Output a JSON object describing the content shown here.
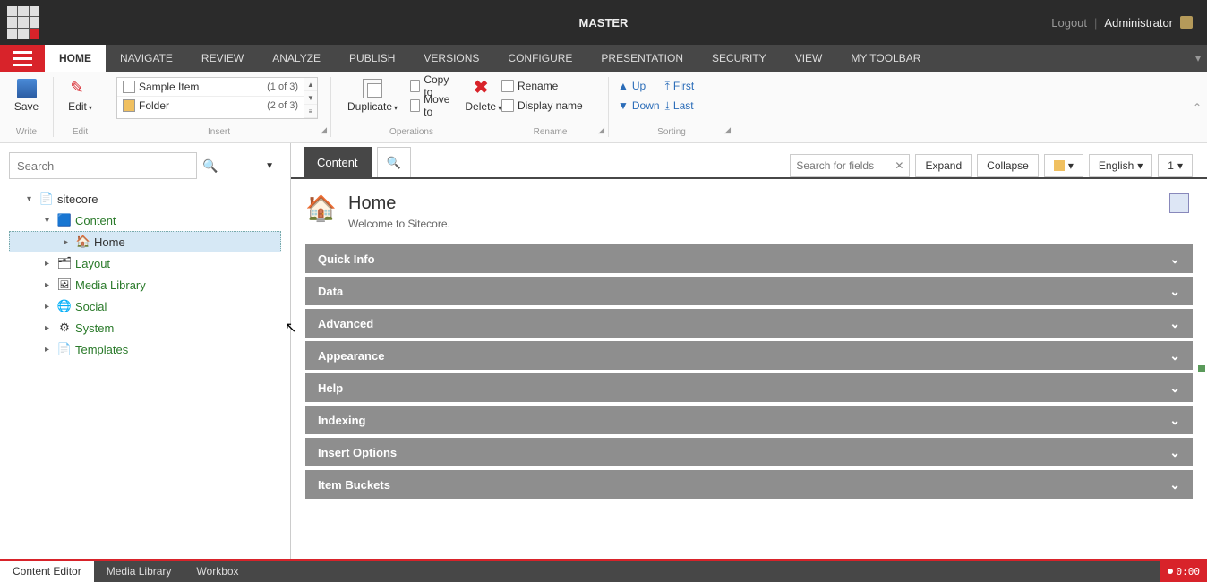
{
  "topbar": {
    "title": "MASTER",
    "logout": "Logout",
    "user": "Administrator"
  },
  "mainnav": {
    "tabs": [
      "HOME",
      "NAVIGATE",
      "REVIEW",
      "ANALYZE",
      "PUBLISH",
      "VERSIONS",
      "CONFIGURE",
      "PRESENTATION",
      "SECURITY",
      "VIEW",
      "MY TOOLBAR"
    ],
    "active": 0
  },
  "ribbon": {
    "write": {
      "save": "Save",
      "label": "Write"
    },
    "edit": {
      "edit": "Edit",
      "label": "Edit"
    },
    "insert": {
      "label": "Insert",
      "rows": [
        {
          "name": "Sample Item",
          "count": "(1 of 3)",
          "icon": "page"
        },
        {
          "name": "Folder",
          "count": "(2 of 3)",
          "icon": "folder"
        }
      ]
    },
    "operations": {
      "label": "Operations",
      "duplicate": "Duplicate",
      "copyto": "Copy to",
      "moveto": "Move to",
      "delete": "Delete"
    },
    "rename": {
      "label": "Rename",
      "rename": "Rename",
      "displayname": "Display name"
    },
    "sorting": {
      "label": "Sorting",
      "up": "Up",
      "down": "Down",
      "first": "First",
      "last": "Last"
    }
  },
  "search": {
    "placeholder": "Search"
  },
  "tree": {
    "root": "sitecore",
    "nodes": [
      {
        "label": "Content",
        "icon": "content",
        "expanded": true,
        "children": [
          {
            "label": "Home",
            "icon": "home",
            "selected": true
          }
        ]
      },
      {
        "label": "Layout",
        "icon": "layout"
      },
      {
        "label": "Media Library",
        "icon": "media"
      },
      {
        "label": "Social",
        "icon": "social"
      },
      {
        "label": "System",
        "icon": "system"
      },
      {
        "label": "Templates",
        "icon": "templates"
      }
    ]
  },
  "rightTabs": {
    "content": "Content",
    "fieldSearch": "Search for fields",
    "expand": "Expand",
    "collapse": "Collapse",
    "language": "English",
    "version": "1"
  },
  "item": {
    "title": "Home",
    "subtitle": "Welcome to Sitecore."
  },
  "sections": [
    "Quick Info",
    "Data",
    "Advanced",
    "Appearance",
    "Help",
    "Indexing",
    "Insert Options",
    "Item Buckets"
  ],
  "bottom": {
    "tabs": [
      "Content Editor",
      "Media Library",
      "Workbox"
    ],
    "active": 0,
    "timer": "0:00"
  }
}
